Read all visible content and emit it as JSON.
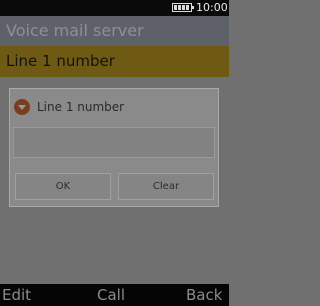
{
  "status_bar": {
    "time": "10:00",
    "battery_icon": "battery-icon"
  },
  "screen": {
    "title": "Voice mail server",
    "selected_item": "Line 1 number"
  },
  "dialog": {
    "title": "Line 1 number",
    "title_icon": "caret-down-icon",
    "input_value": "",
    "ok_label": "OK",
    "clear_label": "Clear"
  },
  "softkeys": {
    "left": "Edit",
    "center": "Call",
    "right": "Back"
  }
}
